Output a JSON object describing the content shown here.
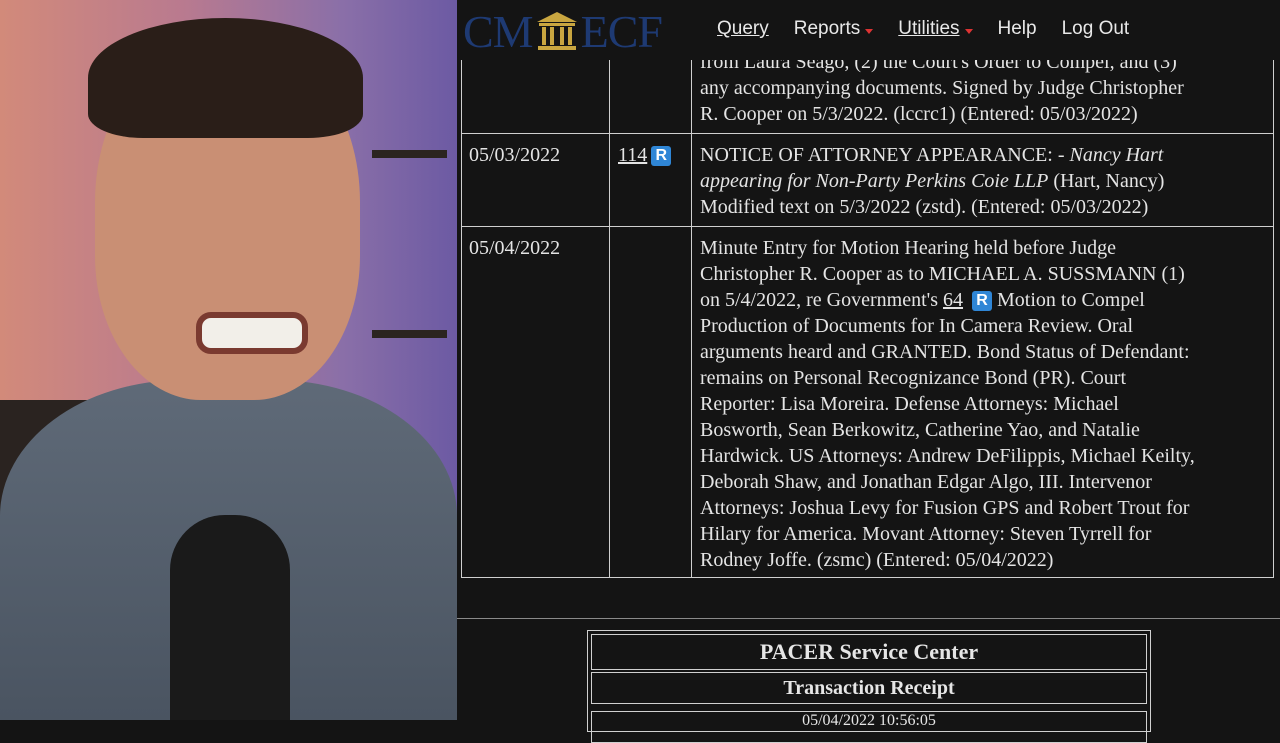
{
  "app": {
    "logo_left": "CM",
    "logo_right": "ECF"
  },
  "nav": {
    "query": "Query",
    "reports": "Reports",
    "utilities": "Utilities",
    "help": "Help",
    "logout": "Log Out"
  },
  "docket": {
    "entry_prev": {
      "line1": "from Laura Seago, (2) the Court's Order to Compel, and (3)",
      "line2": "any accompanying documents. Signed by Judge Christopher",
      "line3": "R. Cooper on 5/3/2022. (lccrc1) (Entered: 05/03/2022)"
    },
    "entry_114": {
      "date": "05/03/2022",
      "number": "114",
      "badge": "R",
      "line1_a": "NOTICE OF ATTORNEY APPEARANCE: - ",
      "line1_b": "Nancy Hart",
      "line2_a": "appearing for Non-Party Perkins Coie LLP",
      "line2_b": " (Hart, Nancy)",
      "line3": "Modified text on 5/3/2022 (zstd). (Entered: 05/03/2022)"
    },
    "entry_minute": {
      "date": "05/04/2022",
      "lines": [
        "Minute Entry for Motion Hearing held before Judge",
        "Christopher R. Cooper as to MICHAEL A. SUSSMANN (1)",
        "Production of Documents for In Camera Review. Oral",
        "arguments heard and GRANTED. Bond Status of Defendant:",
        "remains on Personal Recognizance Bond (PR). Court",
        "Reporter: Lisa Moreira. Defense Attorneys: Michael",
        "Bosworth, Sean Berkowitz, Catherine Yao, and Natalie",
        "Hardwick. US Attorneys: Andrew DeFilippis, Michael Keilty,",
        "Deborah Shaw, and Jonathan Edgar Algo, III. Intervenor",
        "Attorneys: Joshua Levy for Fusion GPS and Robert Trout for",
        "Hilary for America. Movant Attorney: Steven Tyrrell for",
        "Rodney Joffe. (zsmc) (Entered: 05/04/2022)"
      ],
      "line3_a": "on 5/4/2022, re Government's ",
      "line3_link": "64",
      "line3_badge": "R",
      "line3_b": " Motion to Compel"
    }
  },
  "pacer": {
    "title": "PACER Service Center",
    "subtitle": "Transaction Receipt",
    "partial": "05/04/2022 10:56:05"
  }
}
